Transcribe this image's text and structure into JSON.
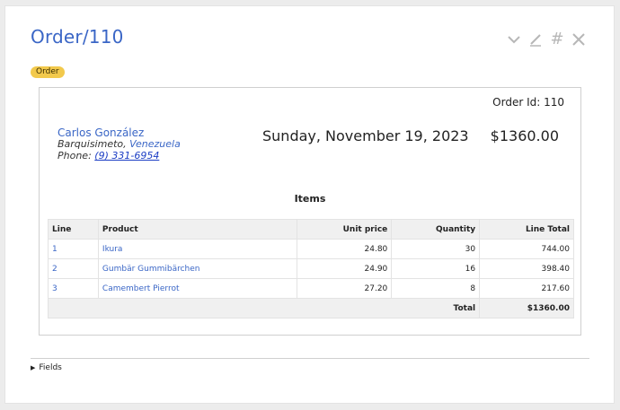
{
  "page": {
    "title": "Order/110",
    "badge": "Order",
    "toolbar": {
      "icons": [
        "chevron-down-icon",
        "pencil-icon",
        "hash-icon",
        "close-icon"
      ],
      "hash_glyph": "#"
    }
  },
  "order": {
    "id_label": "Order Id: 110",
    "customer_name": "Carlos González",
    "city": "Barquisimeto,",
    "country": "Venezuela",
    "phone_label": "Phone:",
    "phone": "(9) 331-6954",
    "date": "Sunday, November 19, 2023",
    "total": "$1360.00"
  },
  "items": {
    "title": "Items",
    "columns": [
      "Line",
      "Product",
      "Unit price",
      "Quantity",
      "Line Total"
    ],
    "rows": [
      {
        "line": "1",
        "product": "Ikura",
        "unit_price": "24.80",
        "quantity": "30",
        "line_total": "744.00"
      },
      {
        "line": "2",
        "product": "Gumbär Gummibärchen",
        "unit_price": "24.90",
        "quantity": "16",
        "line_total": "398.40"
      },
      {
        "line": "3",
        "product": "Camembert Pierrot",
        "unit_price": "27.20",
        "quantity": "8",
        "line_total": "217.60"
      }
    ],
    "footer_label": "Total",
    "footer_total": "$1360.00"
  },
  "fields": {
    "label": "Fields"
  },
  "colors": {
    "accent": "#3a66c6",
    "badge": "#f2c94c",
    "header_bg": "#f0f0f0"
  }
}
